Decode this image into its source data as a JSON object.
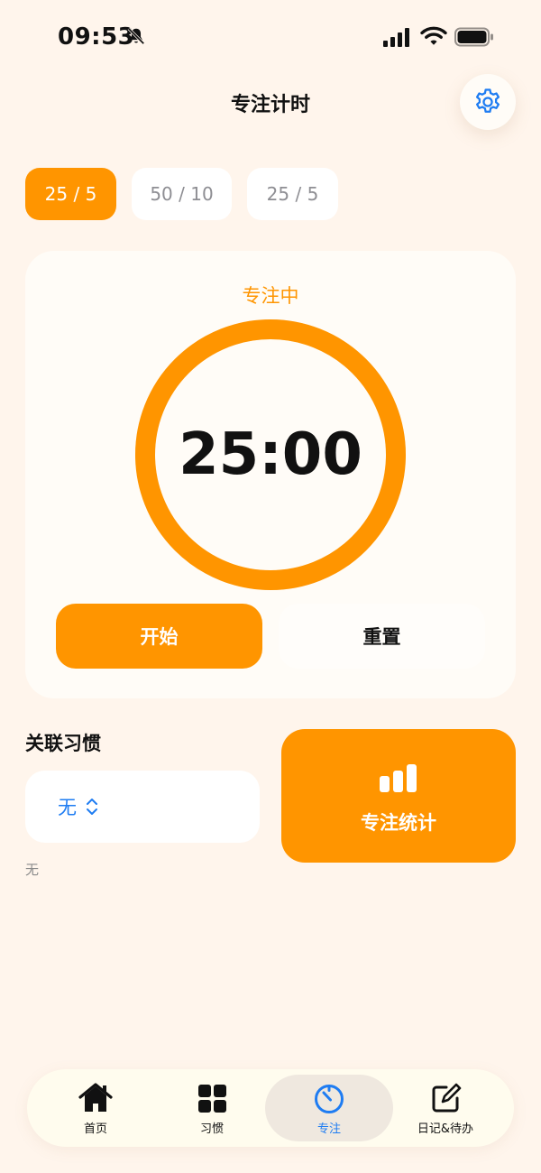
{
  "status_bar": {
    "time": "09:53"
  },
  "header": {
    "title": "专注计时"
  },
  "presets": [
    {
      "label": "25 / 5"
    },
    {
      "label": "50 / 10"
    },
    {
      "label": "25 / 5"
    }
  ],
  "timer": {
    "status": "专注中",
    "remaining": "25:00",
    "progress": 1.0,
    "start_label": "开始",
    "reset_label": "重置"
  },
  "habit_link": {
    "label": "关联习惯",
    "selected": "无",
    "caption": "无"
  },
  "stats": {
    "label": "专注统计"
  },
  "tab_bar": {
    "items": [
      {
        "label": "首页",
        "icon": "home-icon"
      },
      {
        "label": "习惯",
        "icon": "grid-icon"
      },
      {
        "label": "专注",
        "icon": "timer-icon"
      },
      {
        "label": "日记&待办",
        "icon": "edit-icon"
      }
    ],
    "active": "专注"
  },
  "colors": {
    "accent": "#FF9500",
    "link": "#1E7CF2",
    "background": "#FFF5EC",
    "card": "#FFFCF7"
  }
}
